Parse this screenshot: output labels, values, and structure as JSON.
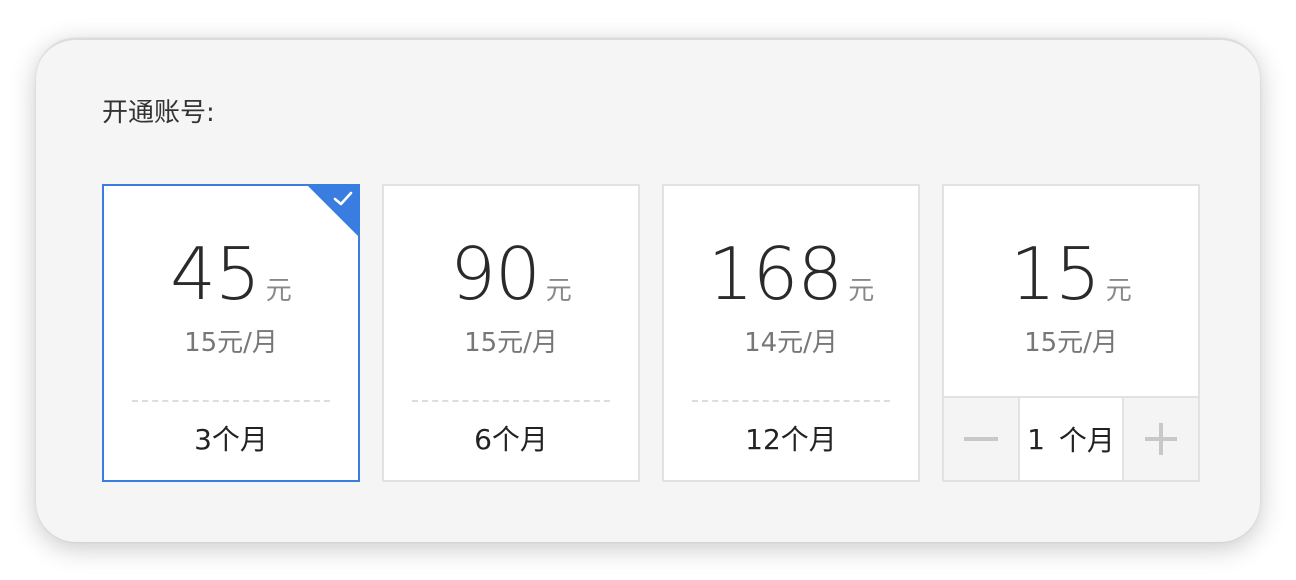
{
  "section": {
    "title": "开通账号:"
  },
  "plans": [
    {
      "price": "45",
      "unit": "元",
      "per_month": "15元/月",
      "duration": "3个月",
      "selected": true
    },
    {
      "price": "90",
      "unit": "元",
      "per_month": "15元/月",
      "duration": "6个月",
      "selected": false
    },
    {
      "price": "168",
      "unit": "元",
      "per_month": "14元/月",
      "duration": "12个月",
      "selected": false
    }
  ],
  "custom_plan": {
    "price": "15",
    "unit": "元",
    "per_month": "15元/月",
    "quantity": "1",
    "quantity_unit": "个月",
    "minus_icon": "minus-icon",
    "plus_icon": "plus-icon"
  },
  "colors": {
    "accent": "#3a7de0",
    "card_border": "#e2e2e2",
    "panel_bg": "#f5f5f5"
  },
  "icons": {
    "selected": "checkmark-icon"
  }
}
